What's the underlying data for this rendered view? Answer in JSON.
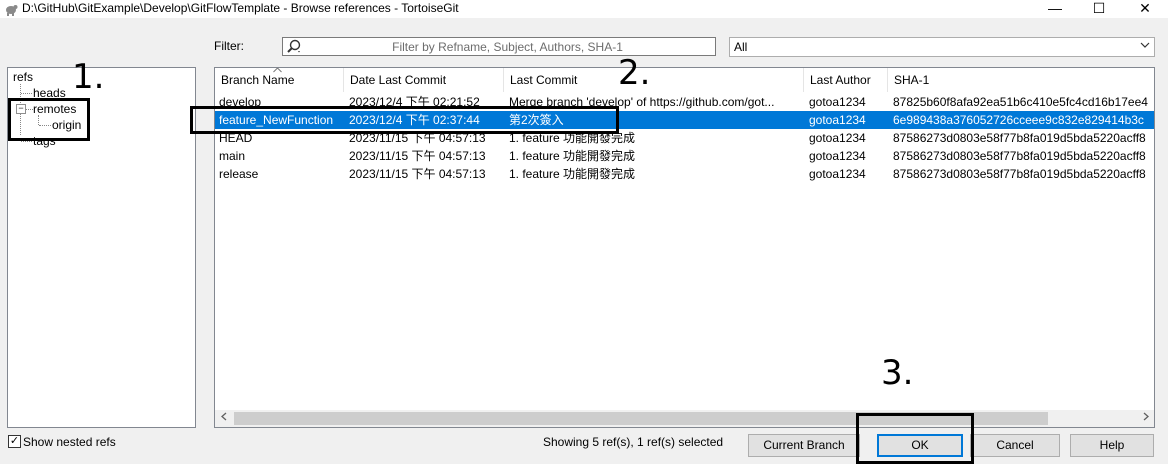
{
  "window": {
    "title": "D:\\GitHub\\GitExample\\Develop\\GitFlowTemplate - Browse references - TortoiseGit",
    "icon": "tortoisegit-icon",
    "minimize": "—",
    "maximize": "☐",
    "close": "✕"
  },
  "filter": {
    "label": "Filter:",
    "placeholder": "Filter by Refname, Subject, Authors, SHA-1",
    "scope_value": "All"
  },
  "tree": {
    "root": "refs",
    "heads": "heads",
    "remotes": "remotes",
    "origin": "origin",
    "tags": "tags",
    "expander_symbol": "−"
  },
  "table": {
    "columns": [
      "Branch Name",
      "Date Last Commit",
      "Last Commit",
      "Last Author",
      "SHA-1"
    ],
    "rows": [
      [
        "develop",
        "2023/12/4 下午 02:21:52",
        "Merge branch 'develop' of https://github.com/got...",
        "gotoa1234",
        "87825b60f8afa92ea51b6c410e5fc4cd16b17ee4"
      ],
      [
        "feature_NewFunction",
        "2023/12/4 下午 02:37:44",
        "第2次簽入",
        "gotoa1234",
        "6e989438a376052726cceee9c832e829414b3c"
      ],
      [
        "HEAD",
        "2023/11/15 下午 04:57:13",
        "1. feature 功能開發完成",
        "gotoa1234",
        "87586273d0803e58f77b8fa019d5bda5220acff8"
      ],
      [
        "main",
        "2023/11/15 下午 04:57:13",
        "1. feature 功能開發完成",
        "gotoa1234",
        "87586273d0803e58f77b8fa019d5bda5220acff8"
      ],
      [
        "release",
        "2023/11/15 下午 04:57:13",
        "1. feature 功能開發完成",
        "gotoa1234",
        "87586273d0803e58f77b8fa019d5bda5220acff8"
      ]
    ],
    "selected_row": 1
  },
  "footer": {
    "show_nested_label": "Show nested refs",
    "show_nested_checked": "✓",
    "status_text": "Showing 5 ref(s), 1 ref(s) selected",
    "current_branch_button": "Current Branch",
    "ok_button": "OK",
    "cancel_button": "Cancel",
    "help_button": "Help"
  },
  "annotations": {
    "step1": "1.",
    "step2": "2.",
    "step3": "3."
  },
  "colors": {
    "selection": "#0078d7",
    "annotation": "#000000"
  }
}
